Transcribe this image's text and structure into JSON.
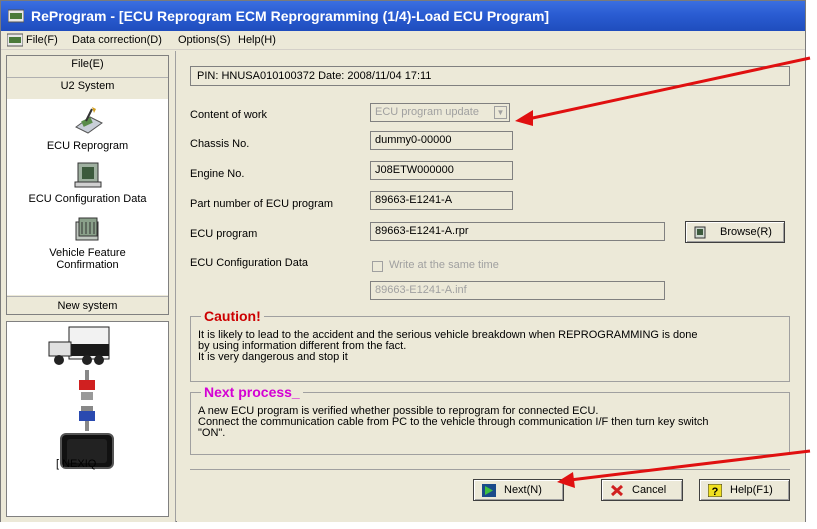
{
  "window": {
    "title": "ReProgram - [ECU Reprogram ECM Reprogramming (1/4)-Load ECU Program]"
  },
  "menu": [
    "File(F)",
    "Data correction(D)",
    "Options(S)",
    "Help(H)"
  ],
  "sidebar": {
    "file_header": "File(E)",
    "system_header": "U2 System",
    "items": [
      {
        "label": "ECU Reprogram",
        "icon": "ecu-reprogram-icon"
      },
      {
        "label": "ECU Configuration Data",
        "icon": "ecu-config-icon"
      },
      {
        "label_line1": "Vehicle Feature",
        "label_line2": "Confirmation",
        "icon": "vehicle-feature-icon"
      }
    ],
    "new_system": "New system",
    "device_label": "[ NEXIQ"
  },
  "main": {
    "pin_line": "PIN: HNUSA010100372  Date: 2008/11/04 17:11",
    "content_of_work_label": "Content of work",
    "content_of_work_value": "ECU program update",
    "chassis_label": "Chassis No.",
    "chassis_value": "dummy0-00000",
    "engine_label": "Engine No.",
    "engine_value": "J08ETW000000",
    "part_label": "Part number of ECU program",
    "part_value": "89663-E1241-A",
    "program_label": "ECU program",
    "program_value": "89663-E1241-A.rpr",
    "browse_label": "Browse(R)",
    "config_label": "ECU Configuration Data",
    "write_same_time": "Write at the same time",
    "config_value": "89663-E1241-A.inf"
  },
  "caution": {
    "title": "Caution!",
    "line1": "It is likely to lead to the accident and the serious vehicle breakdown when REPROGRAMMING is done",
    "line2": "by using information different from the fact.",
    "line3": "It is very dangerous and stop it"
  },
  "next_process": {
    "title": "Next process_",
    "line1": "A new ECU program is verified whether possible to reprogram for connected ECU.",
    "line2": "Connect the communication cable from PC to the vehicle through communication I/F  then turn key switch",
    "line3": "\"ON\"."
  },
  "buttons": {
    "next": "Next(N)",
    "cancel": "Cancel",
    "help": "Help(F1)"
  },
  "colors": {
    "title_bar": "#2a5cd2",
    "caution_title": "#cc0000",
    "next_title": "#d400d4",
    "annotation_arrow": "#e01010"
  }
}
